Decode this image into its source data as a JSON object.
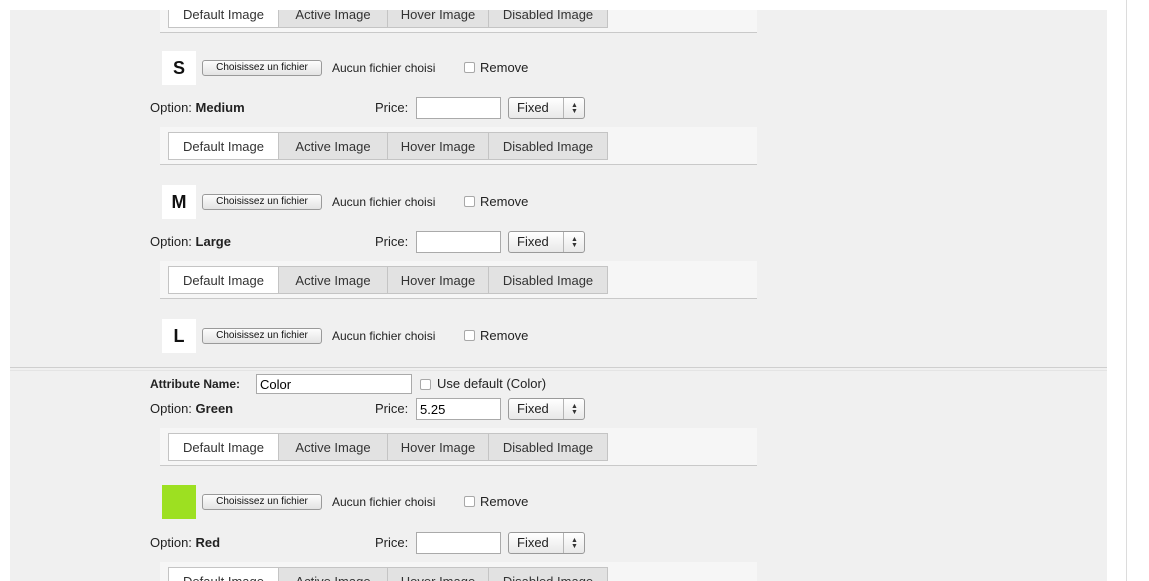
{
  "tab_labels": [
    "Default Image",
    "Active Image",
    "Hover Image",
    "Disabled Image"
  ],
  "file_input": {
    "button_label": "Choisissez un fichier",
    "no_file_text": "Aucun fichier choisi",
    "remove_label": "Remove"
  },
  "option_prefix": "Option:",
  "price_label": "Price:",
  "price_type": "Fixed",
  "size_options": [
    {
      "preview_letter": "S"
    },
    {
      "name": "Medium",
      "price": "",
      "preview_letter": "M"
    },
    {
      "name": "Large",
      "price": "",
      "preview_letter": "L"
    }
  ],
  "color_attribute": {
    "label": "Attribute Name:",
    "value": "Color",
    "use_default_label": "Use default (Color)"
  },
  "color_options": [
    {
      "name": "Green",
      "price": "5.25",
      "swatch_color": "#9de021"
    },
    {
      "name": "Red",
      "price": ""
    }
  ]
}
